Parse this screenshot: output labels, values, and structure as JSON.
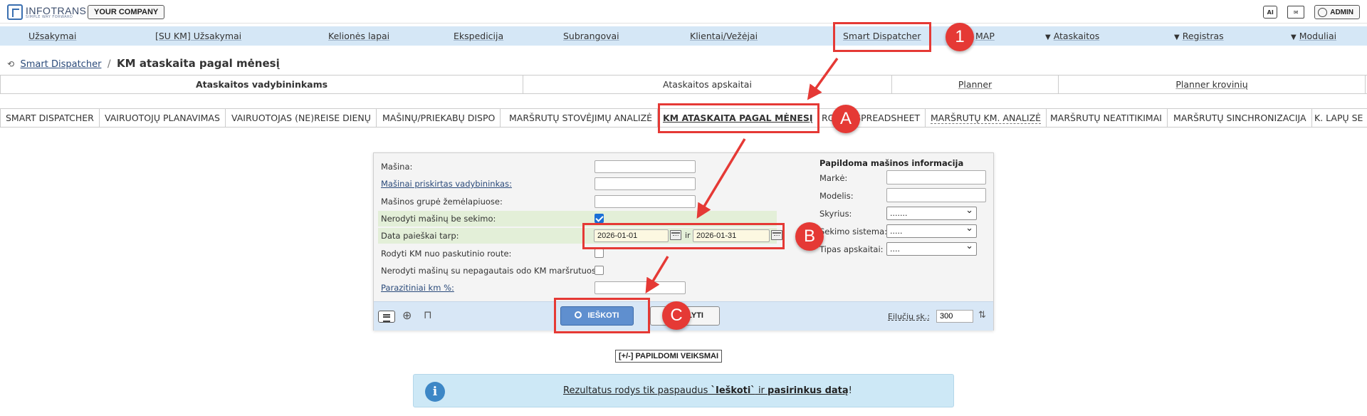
{
  "topbar": {
    "logo_name": "INFOTRANS",
    "logo_tagline": "SIMPLE WAY FORWARD",
    "company_button": "YOUR COMPANY",
    "admin_label": "ADMIN",
    "ai_icon_label": "AI"
  },
  "nav": {
    "items": [
      {
        "label": "Užsakymai"
      },
      {
        "label": "[SU KM] Užsakymai"
      },
      {
        "label": "Kelionės lapai"
      },
      {
        "label": "Ekspedicija"
      },
      {
        "label": "Subrangovai"
      },
      {
        "label": "Klientai/Vežėjai"
      },
      {
        "label": "Smart Dispatcher"
      },
      {
        "label": "MAP"
      },
      {
        "label": "Ataskaitos"
      },
      {
        "label": "Registras"
      },
      {
        "label": "Moduliai"
      }
    ],
    "dropdown_glyph": "▼"
  },
  "breadcrumb": {
    "parent": "Smart Dispatcher",
    "separator": "/",
    "title": "KM ataskaita pagal mėnesį"
  },
  "report_tabs": [
    {
      "label": "Ataskaitos vadybininkams"
    },
    {
      "label": "Ataskaitos apskaitai"
    },
    {
      "label": "Planner"
    },
    {
      "label": "Planner krovinių"
    }
  ],
  "sub_tabs": [
    {
      "label": "SMART DISPATCHER"
    },
    {
      "label": "VAIRUOTOJŲ PLANAVIMAS"
    },
    {
      "label": "VAIRUOTOJAS (NE)REISE DIENŲ"
    },
    {
      "label": "MAŠINŲ/PRIEKABŲ DISPO"
    },
    {
      "label": "MARŠRUTŲ STOVĖJIMŲ ANALIZĖ"
    },
    {
      "label": "KM ATASKAITA PAGAL MĖNESĮ"
    },
    {
      "label": "ROUTE SPREADSHEET"
    },
    {
      "label": "MARŠRUTŲ KM. ANALIZĖ"
    },
    {
      "label": "MARŠRUTŲ NEATITIKIMAI"
    },
    {
      "label": "MARŠRUTŲ SINCHRONIZACIJA"
    },
    {
      "label": "K. LAPŲ SE"
    }
  ],
  "form": {
    "fields": [
      {
        "label": "Mašina:",
        "value": ""
      },
      {
        "label": "Mašinai priskirtas vadybininkas:",
        "value": ""
      },
      {
        "label": "Mašinos grupė žemėlapiuose:",
        "value": ""
      },
      {
        "label": "Nerodyti mašinų be sekimo:",
        "checked": true
      },
      {
        "label": "Data paieškai tarp:",
        "from": "2026-01-01",
        "between": "ir",
        "to": "2026-01-31"
      },
      {
        "label": "Rodyti KM nuo paskutinio route:",
        "checked": false
      },
      {
        "label": "Nerodyti mašinų su nepagautais odo KM maršrutuose:",
        "checked": false
      },
      {
        "label": "Parazitiniai km %:",
        "value": ""
      }
    ],
    "side": {
      "title": "Papildoma mašinos informacija",
      "rows": [
        {
          "label": "Markė:",
          "value": ""
        },
        {
          "label": "Modelis:",
          "value": ""
        },
        {
          "label": "Skyrius:",
          "value": "......."
        },
        {
          "label": "Sekimo sistema:",
          "value": "....."
        },
        {
          "label": "Tipas apskaitai:",
          "value": "...."
        }
      ]
    },
    "search_button": "IEŠKOTI",
    "clear_button": "IŠVALYTI",
    "rows_label": "Eilučių sk.:",
    "rows_value": "300"
  },
  "extra_actions": "[+/-] PAPILDOMI VEIKSMAI",
  "info": {
    "before": "Rezultatus rodys tik paspaudus ",
    "bold1": "`Ieškoti`",
    "mid": " ir ",
    "bold2": "pasirinkus datą",
    "after": "!"
  },
  "annotations": {
    "marker_1": "1",
    "marker_a": "A",
    "marker_b": "B",
    "marker_c": "C",
    "color": "#e53935"
  }
}
